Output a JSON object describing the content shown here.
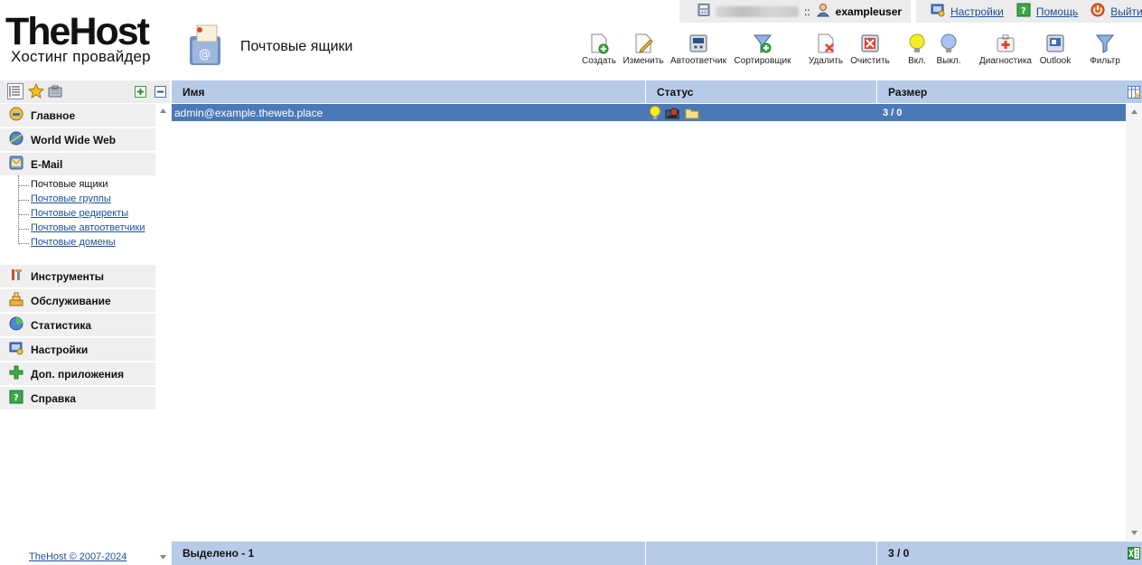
{
  "brand": {
    "logo_title": "TheHost",
    "logo_subtitle": "Хостинг провайдер"
  },
  "page": {
    "title": "Почтовые ящики"
  },
  "user": {
    "separator": "::",
    "username": "exampleuser"
  },
  "top_links": {
    "settings": "Настройки",
    "help": "Помощь",
    "logout": "Выйти"
  },
  "toolbar": {
    "create": "Создать",
    "edit": "Изменить",
    "autoresponder": "Автоответчик",
    "sorter": "Сортировщик",
    "delete": "Удалить",
    "clear": "Очистить",
    "enable": "Вкл.",
    "disable": "Выкл.",
    "diagnostics": "Диагностика",
    "outlook": "Outlook",
    "filter": "Фильтр"
  },
  "sidebar": {
    "items": [
      {
        "label": "Главное",
        "icon": "home-icon"
      },
      {
        "label": "World Wide Web",
        "icon": "globe-icon"
      },
      {
        "label": "E-Mail",
        "icon": "mail-icon"
      },
      {
        "label": "Инструменты",
        "icon": "tools-icon"
      },
      {
        "label": "Обслуживание",
        "icon": "maintenance-icon"
      },
      {
        "label": "Статистика",
        "icon": "pie-chart-icon"
      },
      {
        "label": "Настройки",
        "icon": "settings-icon"
      },
      {
        "label": "Доп. приложения",
        "icon": "plus-icon"
      },
      {
        "label": "Справка",
        "icon": "help-icon"
      }
    ],
    "email_sub": [
      "Почтовые ящики",
      "Почтовые группы",
      "Почтовые редиректы",
      "Почтовые автоответчики",
      "Почтовые домены"
    ],
    "footer": "TheHost © 2007-2024"
  },
  "table": {
    "columns": [
      "Имя",
      "Статус",
      "Размер"
    ],
    "rows": [
      {
        "name": "admin@example.theweb.place",
        "size": "3 / 0",
        "status_icons": [
          "bulb-on-icon",
          "spam-filter-icon",
          "folder-icon"
        ]
      }
    ],
    "footer": {
      "selected": "Выделено - 1",
      "status": "",
      "size": "3 / 0"
    }
  }
}
